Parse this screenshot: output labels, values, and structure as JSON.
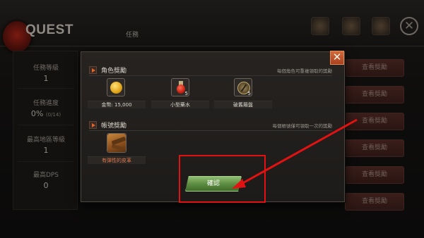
{
  "header": {
    "title": "QUEST",
    "tab": "任務",
    "close_symbol": "✕"
  },
  "stats": [
    {
      "label": "任務等級",
      "value": "1"
    },
    {
      "label": "任務進度",
      "value": "0%",
      "sub": "(0/14)"
    },
    {
      "label": "最高地區等級",
      "value": "1"
    },
    {
      "label": "最高DPS",
      "value": "0"
    }
  ],
  "side_buttons": [
    "查看獎勵",
    "查看獎勵",
    "查看獎勵",
    "查看獎勵",
    "查看獎勵",
    "查看獎勵"
  ],
  "modal": {
    "close_symbol": "✕",
    "character_section": {
      "title": "角色獎勵",
      "note": "每個角色可重複領取的獎勵",
      "items": [
        {
          "icon": "gold-coin-icon",
          "name": "金幣: 15,000",
          "count": ""
        },
        {
          "icon": "red-potion-icon",
          "name": "小型藥水",
          "count": "5"
        },
        {
          "icon": "compass-icon",
          "name": "破舊羅盤",
          "count": "5"
        }
      ]
    },
    "account_section": {
      "title": "帳號獎勵",
      "note": "每個帳號僅可領取一次的獎勵",
      "items": [
        {
          "icon": "leather-icon",
          "name": "有彈性的皮革",
          "count": ""
        }
      ]
    },
    "confirm_label": "確認"
  },
  "colors": {
    "annotation": "#e31212",
    "confirm_green": "#5a8a3f",
    "close_orange": "#c45530"
  }
}
